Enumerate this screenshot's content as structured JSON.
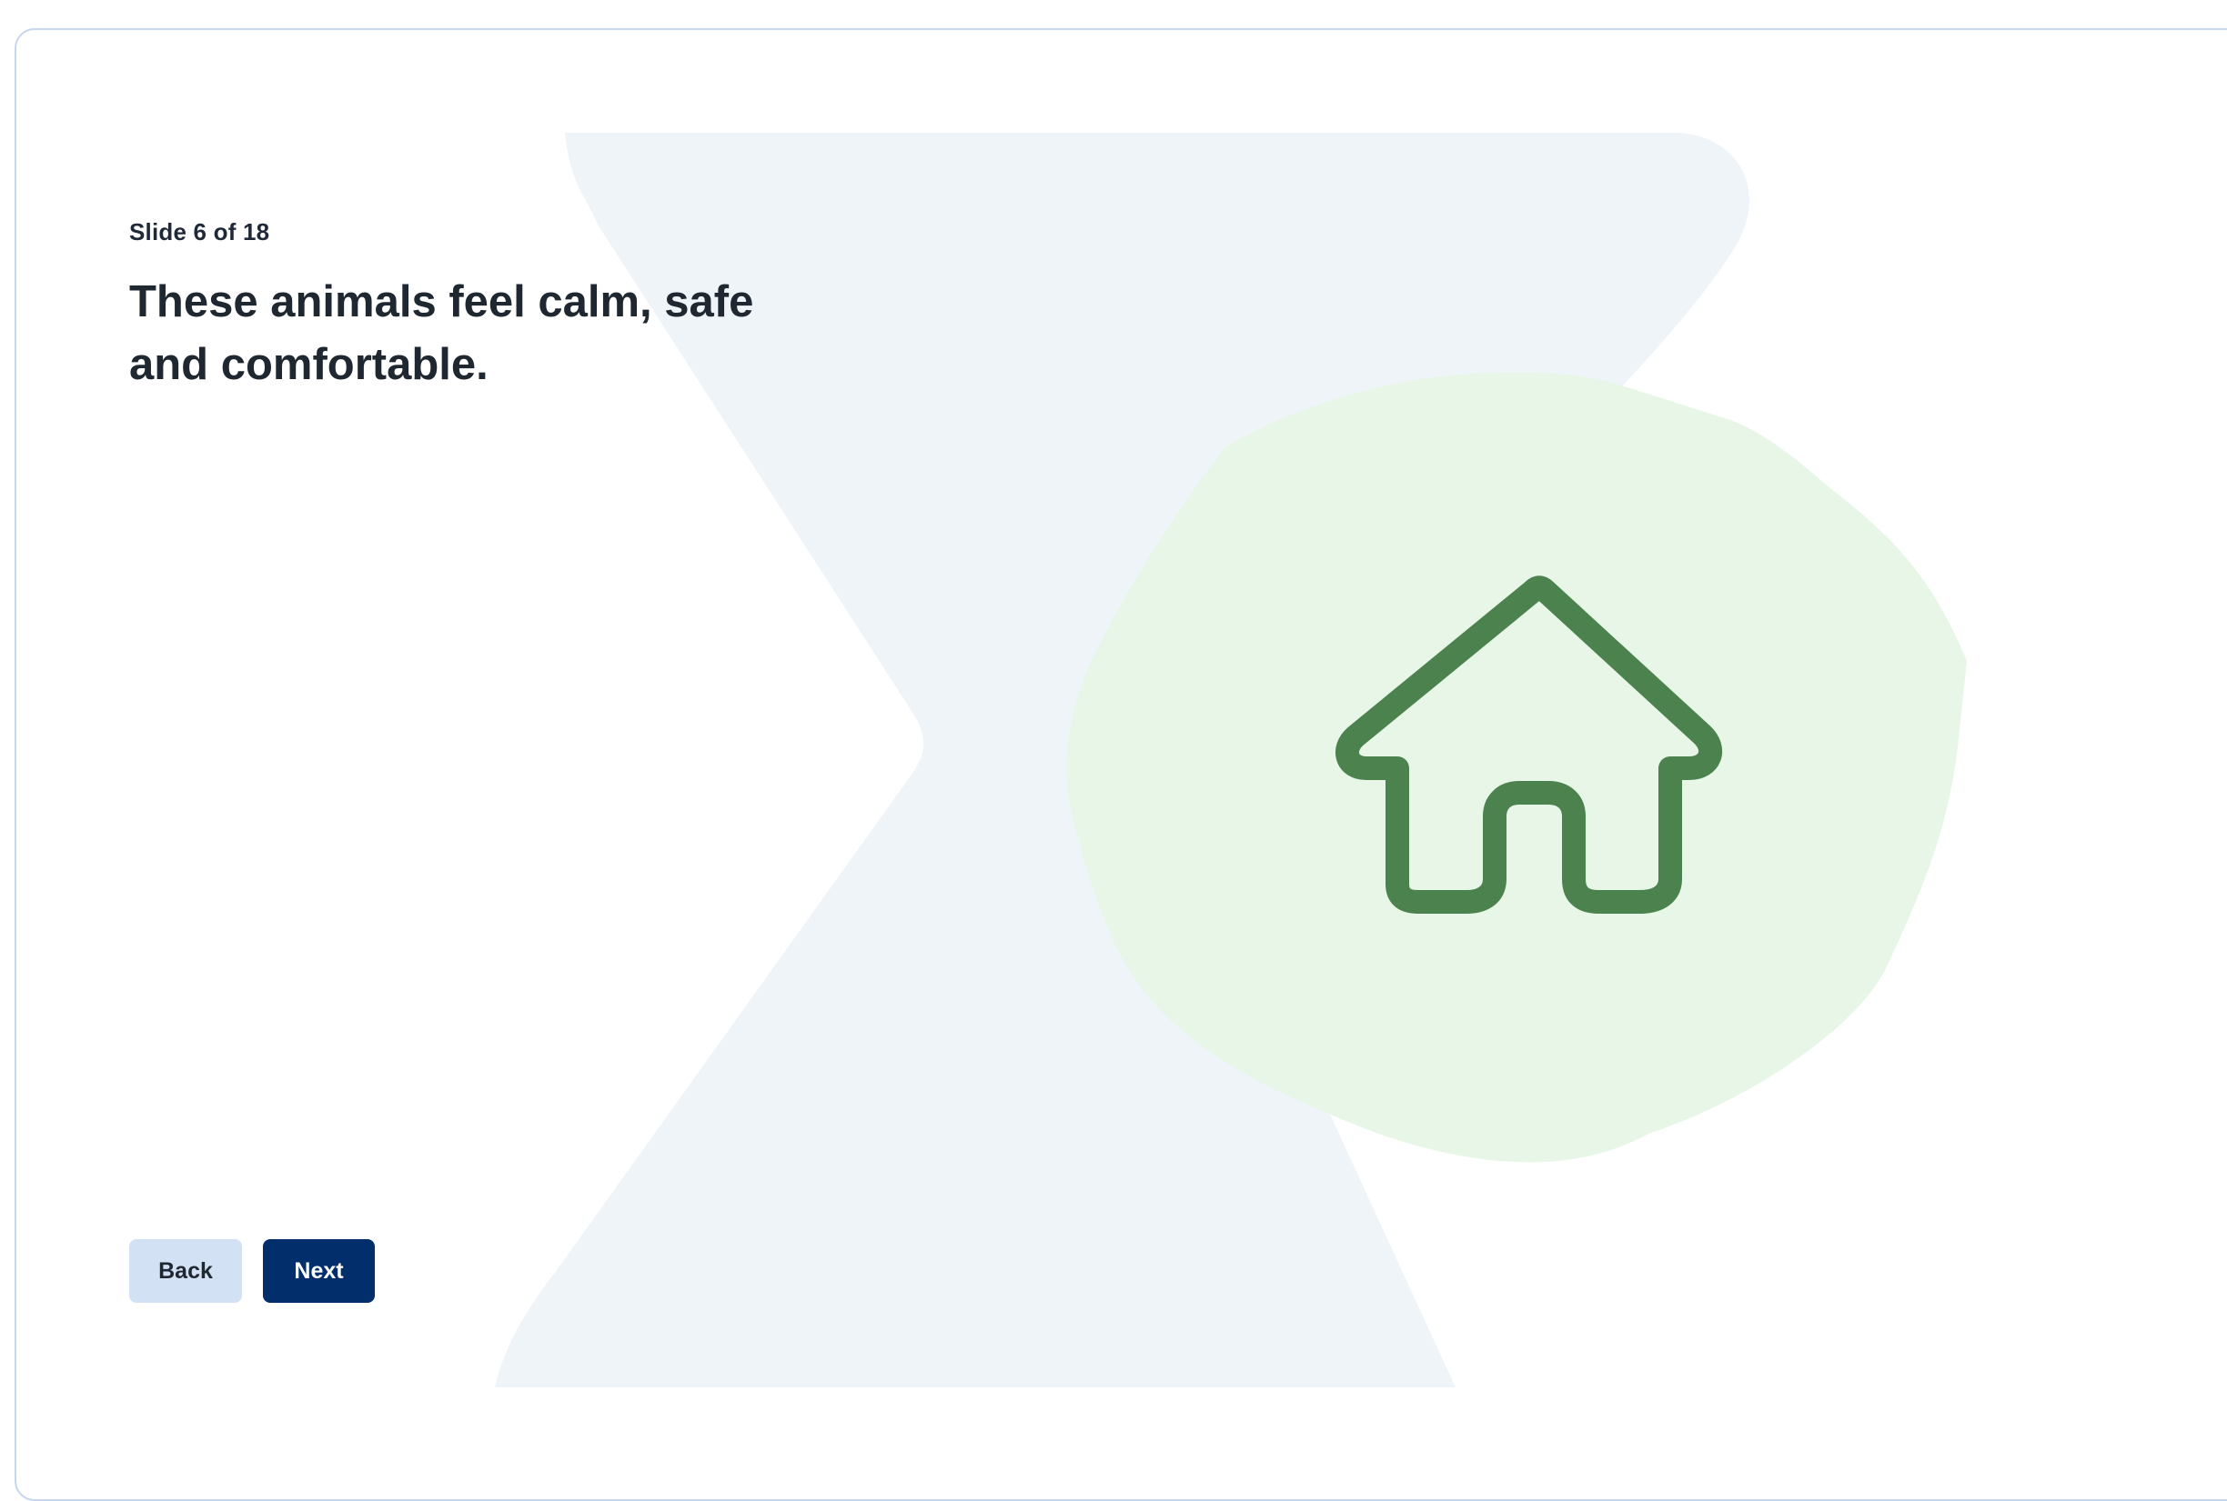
{
  "slide": {
    "counter": "Slide 6 of 18",
    "title": "These animals feel calm, safe and comfortable."
  },
  "navigation": {
    "back_label": "Back",
    "next_label": "Next"
  },
  "illustration": {
    "icon": "home-icon",
    "colors": {
      "background_shape": "#eff4f9",
      "blob": "#e7f6e7",
      "icon_stroke": "#4b824e"
    }
  },
  "colors": {
    "next_button": "#022f6b",
    "back_button": "#d3e1f4",
    "card_border": "#c6d6ee",
    "text": "#1f2731"
  }
}
